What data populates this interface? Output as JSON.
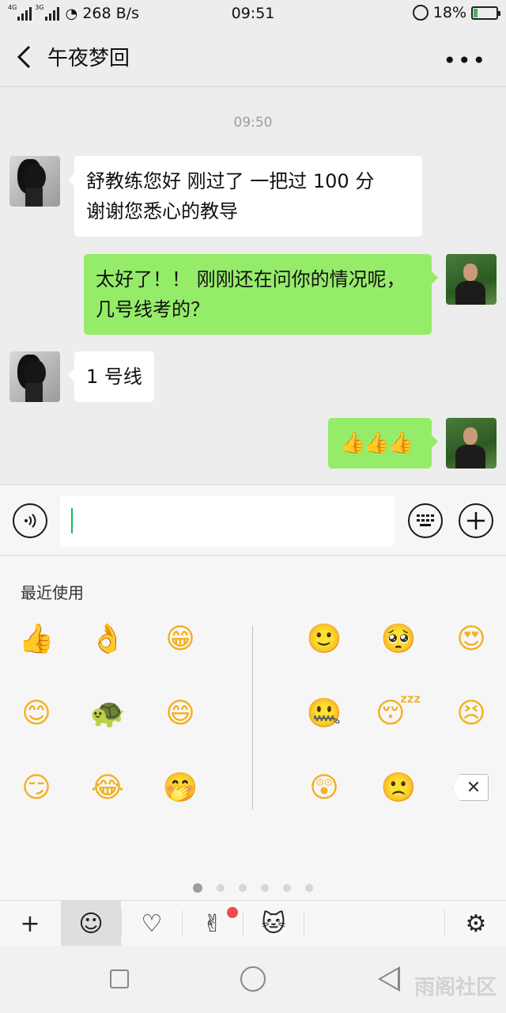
{
  "status_bar": {
    "net1": "4G",
    "net2": "3G",
    "speed": "268 B/s",
    "time": "09:51",
    "battery": "18%",
    "battery_level": 0.18
  },
  "header": {
    "back_icon": "chevron-left-icon",
    "title": "午夜梦回",
    "more": "•••"
  },
  "chat": {
    "timestamp": "09:50",
    "messages": [
      {
        "side": "in",
        "line1": "舒教练您好  刚过了 一把过 100 分",
        "line2": "谢谢您悉心的教导"
      },
      {
        "side": "out",
        "line1": "太好了！！ 刚刚还在问你的情况呢，",
        "line2": "几号线考的？"
      },
      {
        "side": "in",
        "text": "1 号线"
      },
      {
        "side": "out",
        "text": "👍👍👍"
      }
    ]
  },
  "input_bar": {
    "voice_icon": "voice-icon",
    "keyboard_icon": "keyboard-icon",
    "plus_icon": "plus-icon",
    "value": ""
  },
  "emoji_panel": {
    "section_label": "最近使用",
    "recent": [
      "👍",
      "👌",
      "😁",
      "😊",
      "🐢",
      "😄",
      "😏",
      "😂",
      "🤭"
    ],
    "all": [
      "🙂",
      "🥺",
      "😍",
      "🤐",
      "😴",
      "😣",
      "😲",
      "🙁"
    ],
    "backspace": "✕",
    "page_count": 6,
    "current_page": 1
  },
  "tab_bar": {
    "add": "+",
    "emoji_tab": "☺",
    "favorites": "♡",
    "gesture": "✌",
    "sticker": "🐱",
    "settings": "⚙"
  },
  "watermark": "雨阁社区"
}
